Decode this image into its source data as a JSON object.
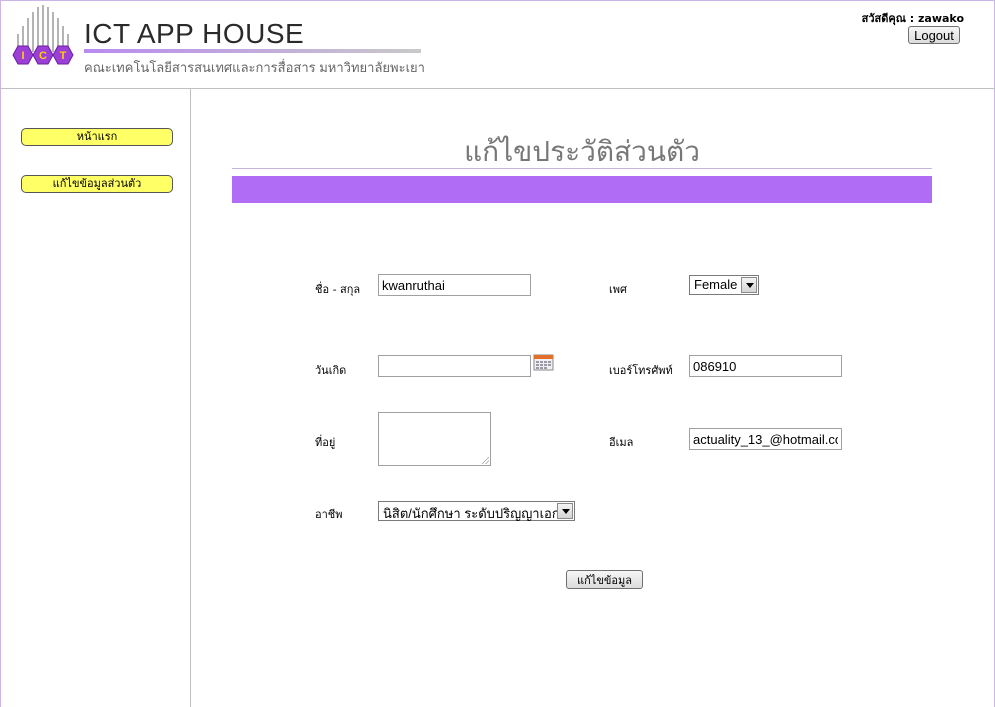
{
  "header": {
    "brand_title": "ICT APP HOUSE",
    "brand_subtitle": "คณะเทคโนโลยีสารสนเทศและการสื่อสาร มหาวิทยาลัยพะเยา",
    "logo_letters": [
      "I",
      "C",
      "T"
    ],
    "greeting": "สวัสดีคุณ : zawako",
    "logout_label": "Logout"
  },
  "sidebar": {
    "items": [
      {
        "label": "หน้าแรก"
      },
      {
        "label": "แก้ไขข้อมูลส่วนตัว"
      }
    ]
  },
  "main": {
    "title": "แก้ไขประวัติส่วนตัว",
    "form": {
      "name_label": "ชื่อ - สกุล",
      "name_value": "kwanruthai",
      "gender_label": "เพศ",
      "gender_value": "Female",
      "birthday_label": "วันเกิด",
      "birthday_value": "",
      "phone_label": "เบอร์โทรศัพท์",
      "phone_value": "086910",
      "address_label": "ที่อยู่",
      "address_value": "",
      "email_label": "อีเมล",
      "email_value": "actuality_13_@hotmail.co",
      "occupation_label": "อาชีพ",
      "occupation_value": "นิสิต/นักศึกษา ระดับปริญญาเอก",
      "submit_label": "แก้ไขข้อมูล"
    }
  },
  "colors": {
    "accent_purple": "#b06cf5",
    "sidebar_button": "#ffff66",
    "logo_hex": "#9b3fd6"
  },
  "icons": [
    "calendar-icon",
    "dropdown-arrow-icon",
    "ict-logo"
  ]
}
